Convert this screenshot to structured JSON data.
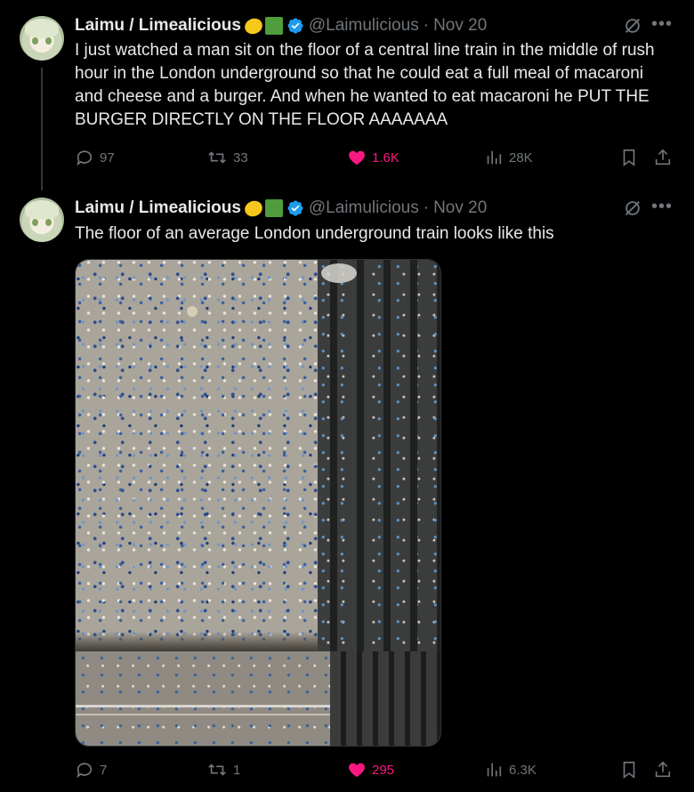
{
  "tweets": [
    {
      "author_name": "Laimu / Limealicious",
      "handle": "@Laimulicious",
      "separator": "·",
      "date": "Nov 20",
      "text": "I just watched a man sit on the floor of a central line train in the middle of rush hour in the London underground so that he could eat a full meal of macaroni and cheese and a burger. And when he wanted to eat macaroni he PUT THE BURGER DIRECTLY ON THE FLOOR AAAAAAA",
      "stats": {
        "replies": "97",
        "reposts": "33",
        "likes": "1.6K",
        "views": "28K"
      }
    },
    {
      "author_name": "Laimu / Limealicious",
      "handle": "@Laimulicious",
      "separator": "·",
      "date": "Nov 20",
      "text": "The floor of an average London underground train looks like this",
      "stats": {
        "replies": "7",
        "reposts": "1",
        "likes": "295",
        "views": "6.3K"
      }
    }
  ],
  "icons": {
    "reply": "reply-icon",
    "repost": "repost-icon",
    "like": "heart-icon",
    "views": "views-icon",
    "bookmark": "bookmark-icon",
    "share": "share-icon",
    "more": "more-icon",
    "grok": "grok-icon",
    "verified": "verified-badge-icon"
  },
  "colors": {
    "background": "#000000",
    "text": "#e7e9ea",
    "muted": "#71767b",
    "like": "#f91880",
    "verified": "#1d9bf0"
  }
}
